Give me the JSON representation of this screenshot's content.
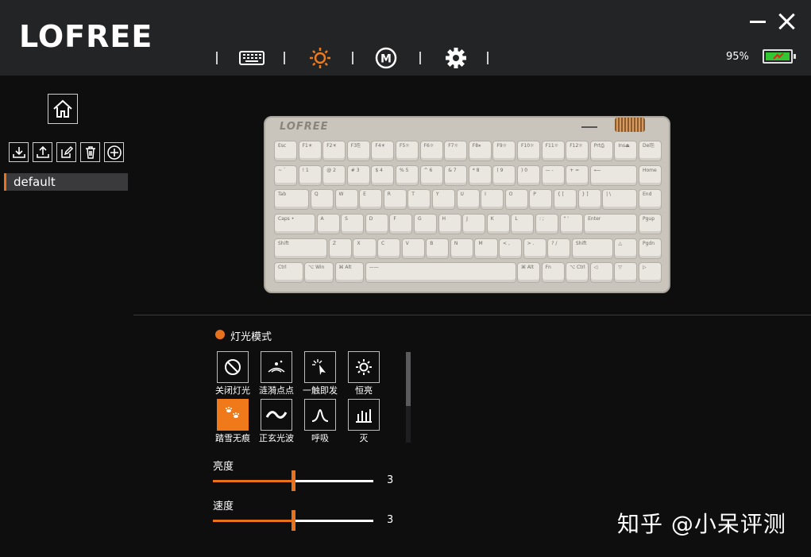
{
  "app": {
    "logo": "LOFREE"
  },
  "battery": {
    "percent_text": "95%",
    "level": 95,
    "color": "#34c532"
  },
  "accent": "#e8711c",
  "nav_tabs": [
    {
      "name": "keyboard-icon",
      "active": false
    },
    {
      "name": "lighting-icon",
      "active": true
    },
    {
      "name": "macro-icon",
      "active": false
    },
    {
      "name": "settings-icon",
      "active": false
    }
  ],
  "sidebar": {
    "profiles": [
      {
        "label": "default",
        "selected": true
      }
    ]
  },
  "keyboard_logo": "LOFREE",
  "keys": [
    [
      "Esc",
      "F1☀",
      "F2☀",
      "F3⎘",
      "F4☀",
      "F5☼",
      "F6☼",
      "F7☼",
      "F8⏸",
      "F9☼",
      "F10☼",
      "F11☼",
      "F12☼",
      "Prt⎙",
      "Ins⏏",
      "Del⎘"
    ],
    [
      "~  `",
      "!  1",
      "@  2",
      "#  3",
      "$  4",
      "%  5",
      "^  6",
      "&  7",
      "*  8",
      "(  9",
      ")  0",
      "—  -",
      "+  =",
      "⟵",
      "Home"
    ],
    [
      "Tab",
      "Q",
      "W",
      "E",
      "R",
      "T",
      "Y",
      "U",
      "I",
      "O",
      "P",
      "{  [",
      "}  ]",
      "|  \\",
      "End"
    ],
    [
      "Caps  •",
      "A",
      "S",
      "D",
      "F",
      "G",
      "H",
      "J",
      "K",
      "L",
      ":  ;",
      "\"  '",
      "Enter",
      "Pgup"
    ],
    [
      "Shift",
      "Z",
      "X",
      "C",
      "V",
      "B",
      "N",
      "M",
      "<  ,",
      ">  .",
      "?  /",
      "Shift",
      "△",
      "Pgdn"
    ],
    [
      "Ctrl",
      "⌥ Win",
      "⌘ Alt",
      "——",
      "⌘ Alt",
      "Fn",
      "⌥ Ctrl",
      "◁",
      "▽",
      "▷"
    ]
  ],
  "lighting": {
    "title": "灯光模式",
    "modes": [
      {
        "label": "关闭灯光",
        "icon": "off-circle-icon",
        "active": false
      },
      {
        "label": "涟漪点点",
        "icon": "ripple-icon",
        "active": false
      },
      {
        "label": "一触即发",
        "icon": "touch-icon",
        "active": false
      },
      {
        "label": "恒亮",
        "icon": "sun-icon",
        "active": false
      },
      {
        "label": "踏雪无痕",
        "icon": "snow-step-icon",
        "active": true
      },
      {
        "label": "正玄光波",
        "icon": "wave-icon",
        "active": false
      },
      {
        "label": "呼吸",
        "icon": "breath-icon",
        "active": false
      },
      {
        "label": "灭",
        "icon": "fade-icon",
        "active": false
      }
    ],
    "brightness": {
      "label": "亮度",
      "value": "3",
      "level_fraction": 0.5
    },
    "speed": {
      "label": "速度",
      "value": "3",
      "level_fraction": 0.5
    }
  },
  "watermark": "知乎 @小呆评测"
}
